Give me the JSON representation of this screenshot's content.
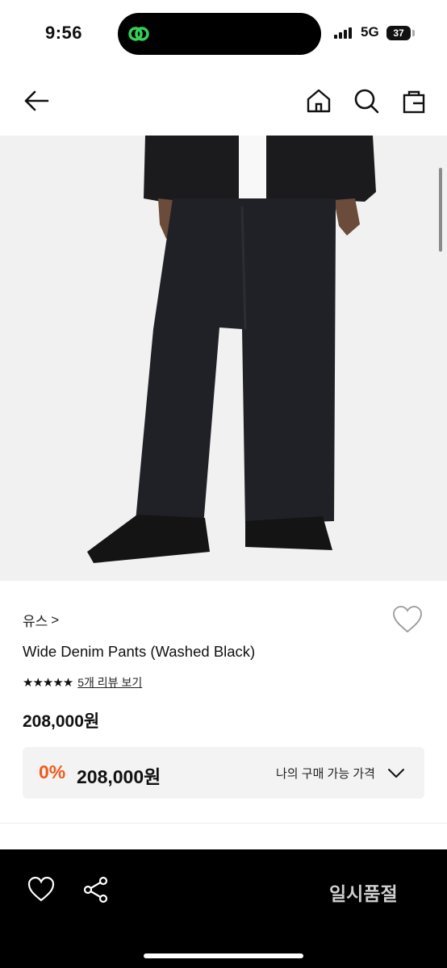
{
  "status_bar": {
    "time": "9:56",
    "network": "5G",
    "battery": "37"
  },
  "header": {
    "back_icon": "arrow-left-icon",
    "home_icon": "home-icon",
    "search_icon": "search-icon",
    "bag_icon": "shopping-bag-icon"
  },
  "product": {
    "image": "product-photo-wide-denim",
    "brand": "유스",
    "brand_chevron": ">",
    "name": "Wide Denim Pants (Washed Black)",
    "stars": "★★★★★",
    "rating": 5,
    "review_link": "5개 리뷰 보기",
    "price": "208,000원"
  },
  "my_price": {
    "discount": "0%",
    "price": "208,000원",
    "label": "나의 구매 가능 가격"
  },
  "bottom_bar": {
    "wish_icon": "heart-icon",
    "share_icon": "share-icon",
    "status": "일시품절"
  },
  "colors": {
    "accent": "#f05a1a",
    "bottom_bar": "#000000",
    "disabled_text": "#cfcfcf"
  }
}
